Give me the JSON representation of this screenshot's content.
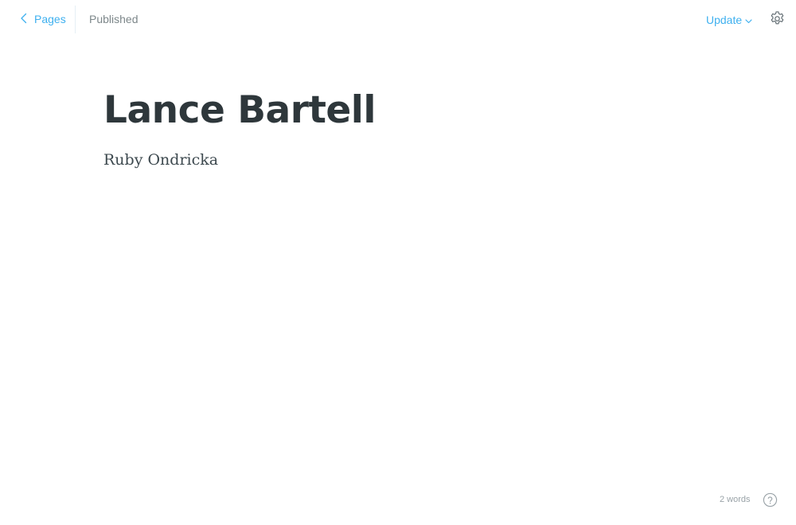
{
  "header": {
    "back_label": "Pages",
    "status": "Published",
    "update_label": "Update"
  },
  "editor": {
    "title": "Lance Bartell",
    "body": "Ruby Ondricka"
  },
  "footer": {
    "word_count": "2 words"
  },
  "icons": {
    "back": "chevron-left-icon",
    "update_dropdown": "chevron-down-icon",
    "settings": "gear-icon",
    "help": "help-circle-icon"
  },
  "colors": {
    "accent": "#3eb0ef",
    "title": "#2e373b",
    "body": "#3c484e",
    "muted": "#7d878a"
  }
}
